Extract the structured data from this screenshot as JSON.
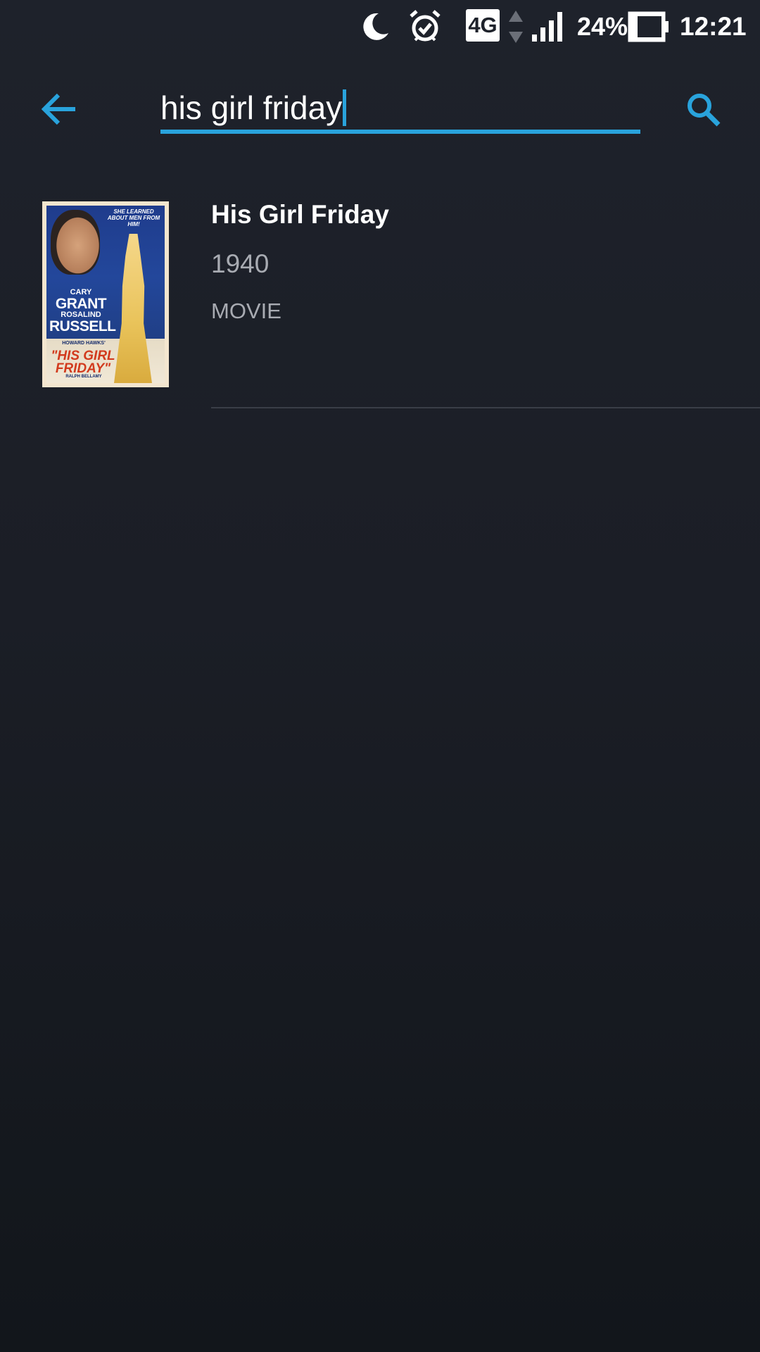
{
  "status_bar": {
    "network": "4G",
    "battery_percent": "24%",
    "time": "12:21",
    "icons": [
      "moon-icon",
      "alarm-icon",
      "network-4g-icon",
      "data-arrows-icon",
      "signal-icon",
      "battery-icon"
    ]
  },
  "toolbar": {
    "back_icon": "arrow-left-icon",
    "search_query": "his girl friday",
    "search_icon": "search-icon",
    "accent_color": "#29a3dc"
  },
  "results": [
    {
      "title": "His Girl Friday",
      "year": "1940",
      "type": "MOVIE",
      "poster": {
        "tagline": "SHE LEARNED ABOUT MEN FROM HIM!",
        "actor1_first": "CARY",
        "actor1_last": "GRANT",
        "actor2_first": "ROSALIND",
        "actor2_last": "RUSSELL",
        "director": "HOWARD HAWKS'",
        "title": "\"HIS GIRL FRIDAY\"",
        "cast": "RALPH BELLAMY"
      }
    }
  ]
}
